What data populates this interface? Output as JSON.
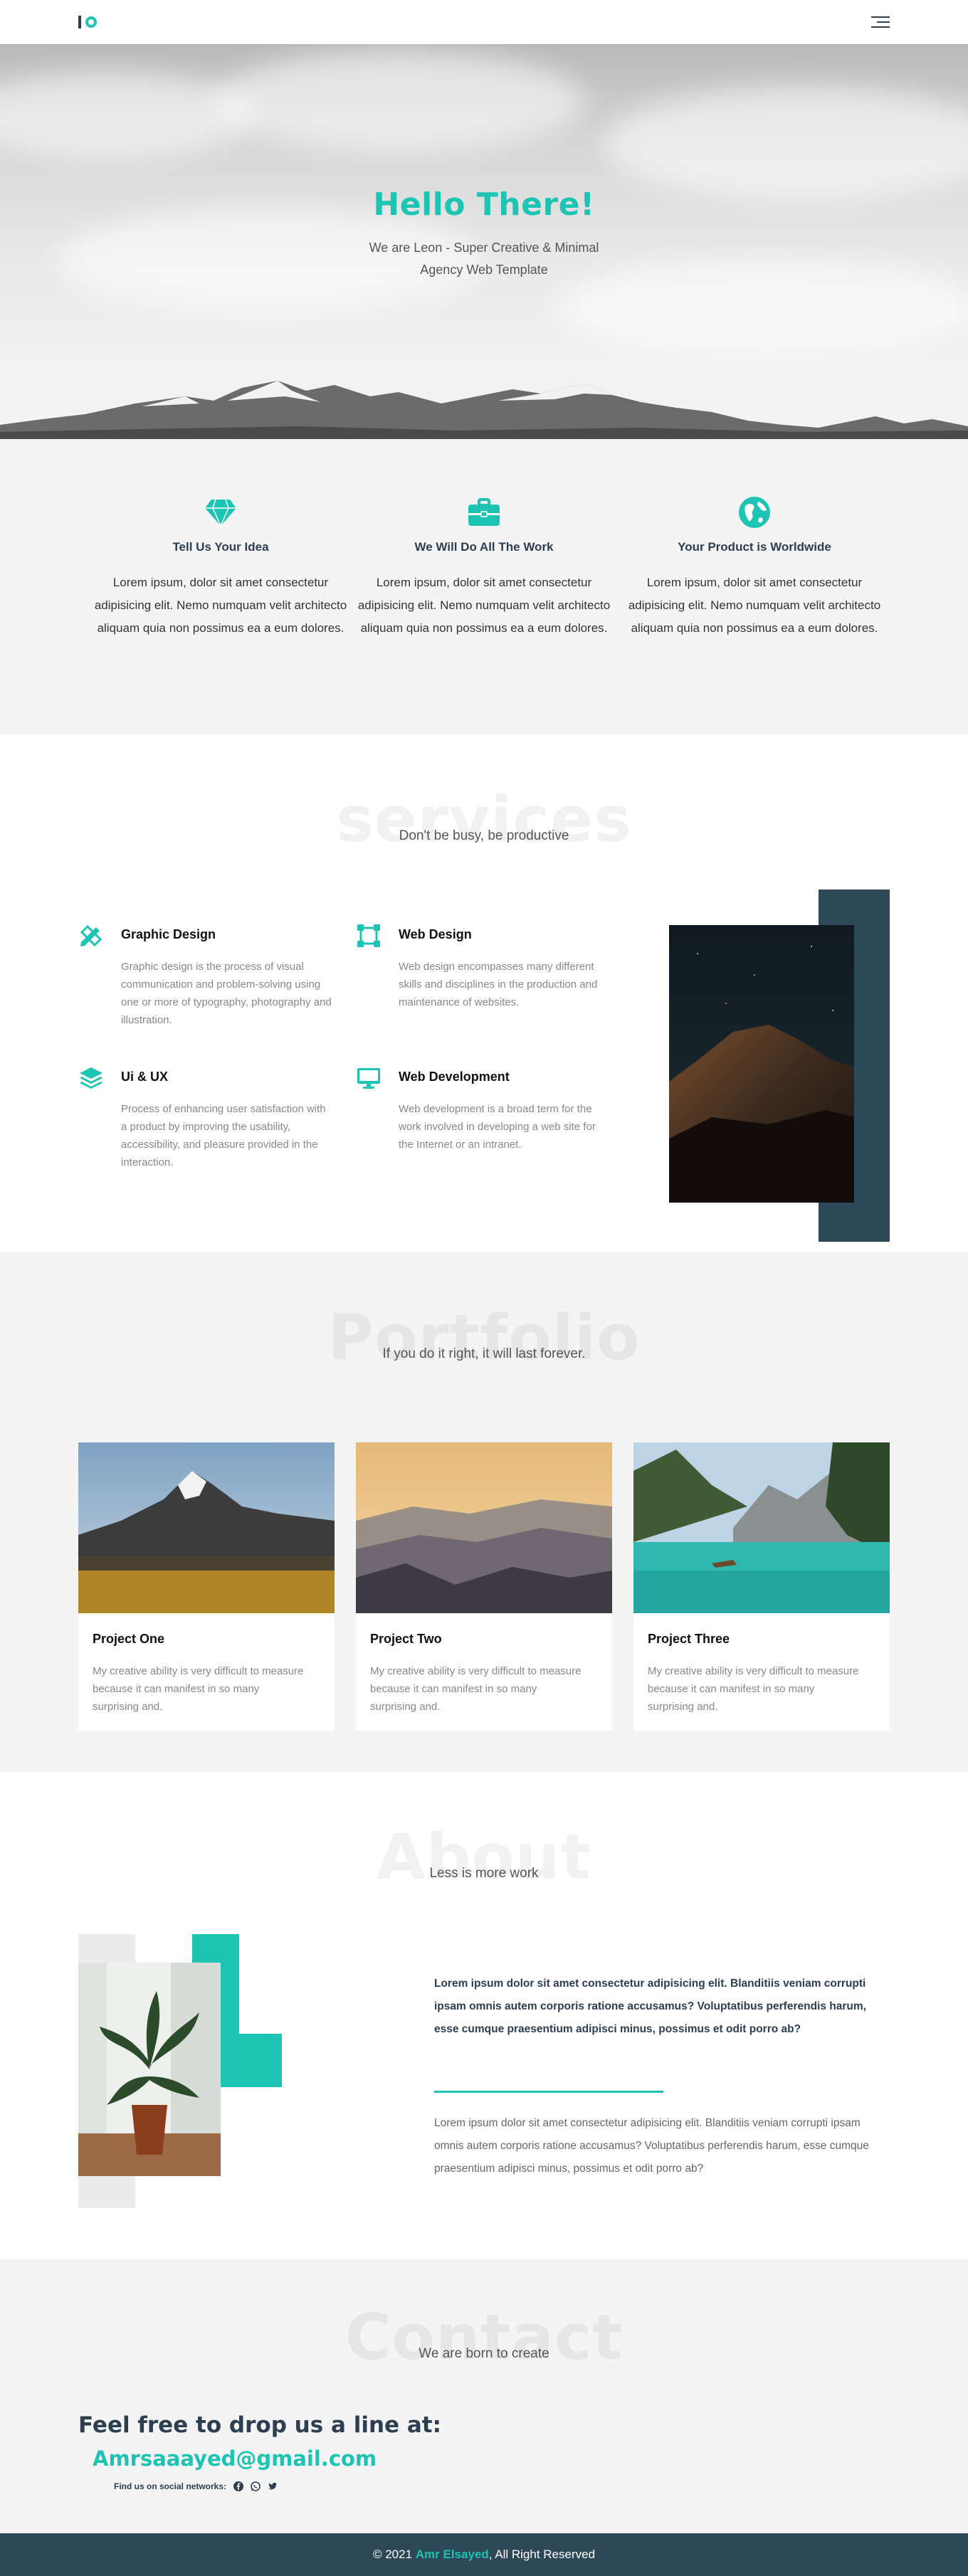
{
  "header": {
    "logo_alt": "Logo",
    "menu_icon": "hamburger-menu-icon"
  },
  "hero": {
    "title": "Hello There!",
    "subtitle": "We are Leon - Super Creative & Minimal Agency Web Template"
  },
  "features": [
    {
      "icon": "diamond-icon",
      "title": "Tell Us Your Idea",
      "text": "Lorem ipsum, dolor sit amet consectetur adipisicing elit. Nemo numquam velit architecto aliquam quia non possimus ea a eum dolores."
    },
    {
      "icon": "briefcase-icon",
      "title": "We Will Do All The Work",
      "text": "Lorem ipsum, dolor sit amet consectetur adipisicing elit. Nemo numquam velit architecto aliquam quia non possimus ea a eum dolores."
    },
    {
      "icon": "globe-icon",
      "title": "Your Product is Worldwide",
      "text": "Lorem ipsum, dolor sit amet consectetur adipisicing elit. Nemo numquam velit architecto aliquam quia non possimus ea a eum dolores."
    }
  ],
  "services": {
    "ghost": "services",
    "subtitle": "Don't be busy, be productive",
    "items": [
      {
        "icon": "pencil-ruler-icon",
        "title": "Graphic Design",
        "text": "Graphic design is the process of visual communication and problem-solving using one or more of typography, photography and illustration."
      },
      {
        "icon": "vector-square-icon",
        "title": "Web Design",
        "text": "Web design encompasses many different skills and disciplines in the production and maintenance of websites."
      },
      {
        "icon": "layers-icon",
        "title": "Ui & UX",
        "text": "Process of enhancing user satisfaction with a product by improving the usability, accessibility, and pleasure provided in the interaction."
      },
      {
        "icon": "desktop-icon",
        "title": "Web Development",
        "text": "Web development is a broad term for the work involved in developing a web site for the Internet or an intranet."
      }
    ]
  },
  "portfolio": {
    "ghost": "Portfolio",
    "subtitle": "If you do it right, it will last forever.",
    "projects": [
      {
        "title": "Project One",
        "text": "My creative ability is very difficult to measure because it can manifest in so many surprising and."
      },
      {
        "title": "Project Two",
        "text": "My creative ability is very difficult to measure because it can manifest in so many surprising and."
      },
      {
        "title": "Project Three",
        "text": "My creative ability is very difficult to measure because it can manifest in so many surprising and."
      }
    ]
  },
  "about": {
    "ghost": "About",
    "subtitle": "Less is more work",
    "bold_text": "Lorem ipsum dolor sit amet consectetur adipisicing elit. Blanditiis veniam corrupti ipsam omnis autem corporis ratione accusamus? Voluptatibus perferendis harum, esse cumque praesentium adipisci minus, possimus et odit porro ab?",
    "text": "Lorem ipsum dolor sit amet consectetur adipisicing elit. Blanditiis veniam corrupti ipsam omnis autem corporis ratione accusamus? Voluptatibus perferendis harum, esse cumque praesentium adipisci minus, possimus et odit porro ab?"
  },
  "contact": {
    "ghost": "Contact",
    "subtitle": "We are born to create",
    "heading": "Feel free to drop us a line at:",
    "email": "Amrsaaayed@gmail.com",
    "social_label": "Find us on social networks:",
    "social_icons": [
      "facebook-icon",
      "whatsapp-icon",
      "twitter-icon"
    ]
  },
  "footer": {
    "prefix": "© 2021 ",
    "name": "Amr Elsayed",
    "suffix": ", All Right Reserved"
  },
  "colors": {
    "accent": "#1ec4b3",
    "dark": "#2d4857",
    "light_bg": "#f4f4f4"
  }
}
